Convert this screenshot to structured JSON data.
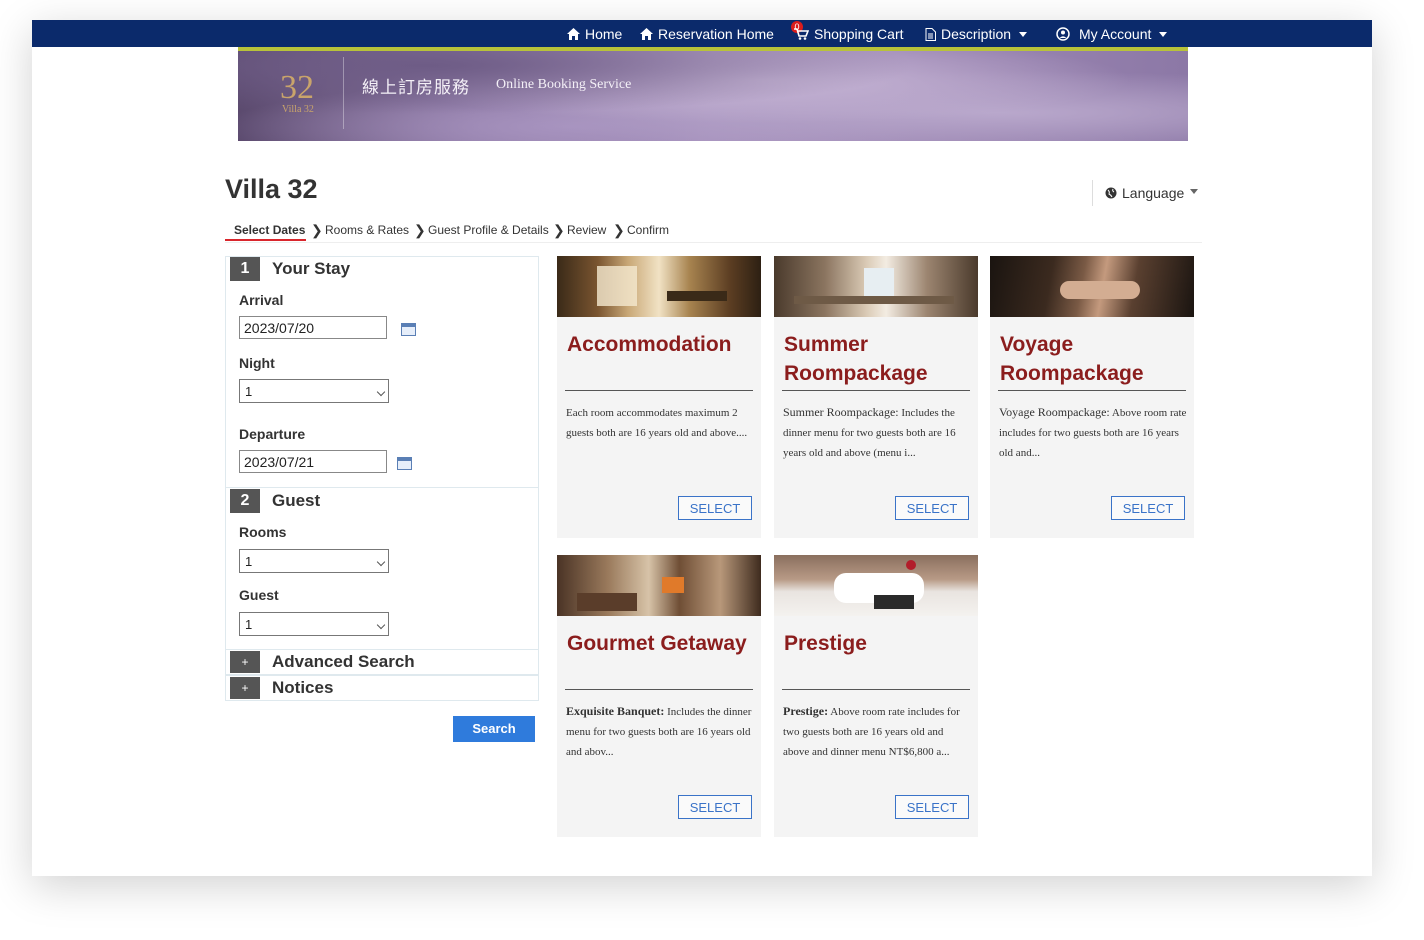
{
  "nav": {
    "home": "Home",
    "reservation_home": "Reservation Home",
    "cart_count": "0",
    "shopping_cart": "Shopping Cart",
    "description": "Description",
    "my_account": "My Account"
  },
  "banner": {
    "logo_number": "32",
    "logo_sub": "Villa 32",
    "title_cn": "線上訂房服務",
    "title_en": "Online Booking Service"
  },
  "page_title": "Villa 32",
  "language": "Language",
  "steps": [
    "Select Dates",
    "Rooms & Rates",
    "Guest Profile & Details",
    "Review",
    "Confirm"
  ],
  "form": {
    "stay": {
      "number": "1",
      "title": "Your Stay"
    },
    "arrival_label": "Arrival",
    "arrival_value": "2023/07/20",
    "night_label": "Night",
    "night_value": "1",
    "departure_label": "Departure",
    "departure_value": "2023/07/21",
    "guest_section": {
      "number": "2",
      "title": "Guest"
    },
    "rooms_label": "Rooms",
    "rooms_value": "1",
    "guest_label": "Guest",
    "guest_value": "1",
    "advanced_search": "Advanced Search",
    "notices": "Notices",
    "plus": "+",
    "search_button": "Search"
  },
  "cards": [
    {
      "title": "Accommodation",
      "desc_lead": "",
      "desc": "Each room accommodates maximum 2 guests both are 16 years old and above....",
      "select": "SELECT"
    },
    {
      "title": "Summer Roompackage",
      "desc_lead": "Summer Roompackage:",
      "desc": "Includes the dinner menu for two guests both are 16 years old and above (menu i...",
      "select": "SELECT"
    },
    {
      "title": "Voyage Roompackage",
      "desc_lead": "Voyage Roompackage:",
      "desc": "Above room rate includes for two guests both are 16 years old and...",
      "select": "SELECT"
    },
    {
      "title": "Gourmet Getaway",
      "desc_lead": "Exquisite Banquet:",
      "desc": "Includes the dinner menu for two guests both are 16 years old and abov...",
      "select": "SELECT"
    },
    {
      "title": "Prestige",
      "desc_lead": "Prestige:",
      "desc": "Above room rate includes for two guests both are 16 years old and above and dinner menu NT$6,800 a...",
      "select": "SELECT"
    }
  ],
  "colors": {
    "nav_bg": "#0b2a6b",
    "card_title": "#8b1d1d",
    "primary_button": "#2f7bdc",
    "active_step_underline": "#d9262c"
  }
}
